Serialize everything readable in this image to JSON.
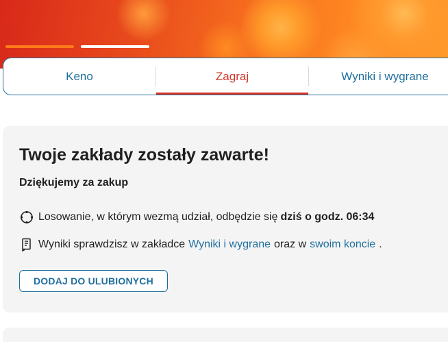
{
  "tabs": [
    {
      "label": "Keno",
      "active": false
    },
    {
      "label": "Zagraj",
      "active": true
    },
    {
      "label": "Wyniki i wygrane",
      "active": false
    }
  ],
  "confirmation": {
    "title": "Twoje zakłady zostały zawarte!",
    "subtitle": "Dziękujemy za zakup",
    "draw_text": "Losowanie, w którym wezmą udział, odbędzie się",
    "draw_time": "dziś o godz. 06:34",
    "results_prefix": "Wyniki sprawdzisz w zakładce",
    "results_link": "Wyniki i wygrane",
    "results_middle": "oraz w",
    "account_link": "swoim koncie",
    "results_suffix": ".",
    "favorites_button": "DODAJ DO ULUBIONYCH"
  },
  "icons": {
    "draw": "lottery-wheel-icon",
    "results": "ticket-icon"
  },
  "colors": {
    "accent_blue": "#1f6f9e",
    "accent_red": "#d1372a",
    "card_bg": "#f4f4f4"
  }
}
